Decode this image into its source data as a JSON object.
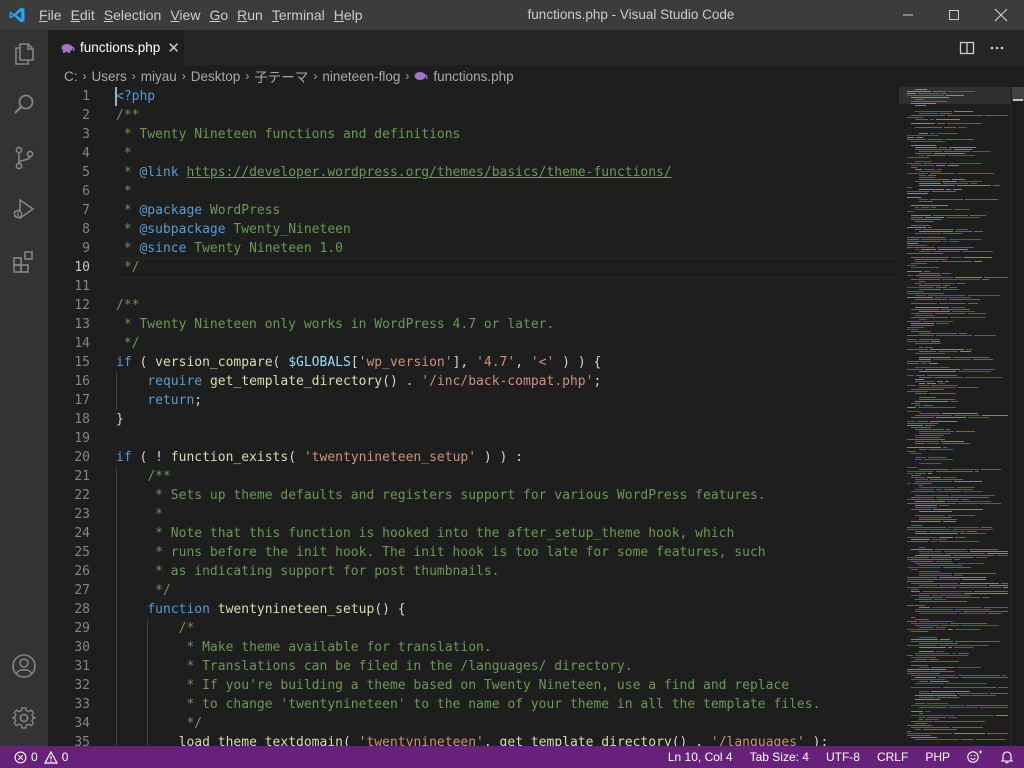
{
  "window": {
    "title": "functions.php - Visual Studio Code",
    "menu": [
      "File",
      "Edit",
      "Selection",
      "View",
      "Go",
      "Run",
      "Terminal",
      "Help"
    ],
    "menu_mnemonic_index": [
      0,
      0,
      0,
      0,
      0,
      0,
      0,
      0
    ]
  },
  "activity_bar": {
    "top": [
      "files-icon",
      "search-icon",
      "source-control-icon",
      "run-debug-icon",
      "extensions-icon"
    ],
    "bottom": [
      "account-icon",
      "manage-gear-icon"
    ],
    "active": "files-icon"
  },
  "tab": {
    "label": "functions.php",
    "close": "✕",
    "icon": "php-elephant-icon"
  },
  "breadcrumb": {
    "items": [
      "C:",
      "Users",
      "miyau",
      "Desktop",
      "子テーマ",
      "nineteen-flog"
    ],
    "file": "functions.php"
  },
  "editor": {
    "active_line": 10,
    "lines": [
      {
        "n": "1",
        "indent": 0,
        "tokens": [
          [
            "tag",
            "<?php"
          ]
        ]
      },
      {
        "n": "2",
        "indent": 0,
        "tokens": [
          [
            "cm",
            "/**"
          ]
        ]
      },
      {
        "n": "3",
        "indent": 0,
        "tokens": [
          [
            "cm",
            " * Twenty Nineteen functions and definitions"
          ]
        ]
      },
      {
        "n": "4",
        "indent": 0,
        "tokens": [
          [
            "cm",
            " *"
          ]
        ]
      },
      {
        "n": "5",
        "indent": 0,
        "tokens": [
          [
            "cm",
            " * "
          ],
          [
            "kw",
            "@link"
          ],
          [
            "cm",
            " "
          ],
          [
            "link",
            "https://developer.wordpress.org/themes/basics/theme-functions/"
          ]
        ]
      },
      {
        "n": "6",
        "indent": 0,
        "tokens": [
          [
            "cm",
            " *"
          ]
        ]
      },
      {
        "n": "7",
        "indent": 0,
        "tokens": [
          [
            "cm",
            " * "
          ],
          [
            "kw",
            "@package"
          ],
          [
            "cm",
            " WordPress"
          ]
        ]
      },
      {
        "n": "8",
        "indent": 0,
        "tokens": [
          [
            "cm",
            " * "
          ],
          [
            "kw",
            "@subpackage"
          ],
          [
            "cm",
            " Twenty_Nineteen"
          ]
        ]
      },
      {
        "n": "9",
        "indent": 0,
        "tokens": [
          [
            "cm",
            " * "
          ],
          [
            "kw",
            "@since"
          ],
          [
            "cm",
            " Twenty Nineteen 1.0"
          ]
        ]
      },
      {
        "n": "10",
        "indent": 0,
        "tokens": [
          [
            "cm",
            " */"
          ]
        ]
      },
      {
        "n": "11",
        "indent": 0,
        "tokens": []
      },
      {
        "n": "12",
        "indent": 0,
        "tokens": [
          [
            "cm",
            "/**"
          ]
        ]
      },
      {
        "n": "13",
        "indent": 0,
        "tokens": [
          [
            "cm",
            " * Twenty Nineteen only works in WordPress 4.7 or later."
          ]
        ]
      },
      {
        "n": "14",
        "indent": 0,
        "tokens": [
          [
            "cm",
            " */"
          ]
        ]
      },
      {
        "n": "15",
        "indent": 0,
        "tokens": [
          [
            "kw",
            "if"
          ],
          [
            "txt",
            " ( "
          ],
          [
            "fn",
            "version_compare"
          ],
          [
            "txt",
            "( "
          ],
          [
            "var",
            "$GLOBALS"
          ],
          [
            "txt",
            "["
          ],
          [
            "str",
            "'wp_version'"
          ],
          [
            "txt",
            "], "
          ],
          [
            "str",
            "'4.7'"
          ],
          [
            "txt",
            ", "
          ],
          [
            "str",
            "'<'"
          ],
          [
            "txt",
            " ) ) {"
          ]
        ]
      },
      {
        "n": "16",
        "indent": 1,
        "tokens": [
          [
            "txt",
            "    "
          ],
          [
            "kw",
            "require"
          ],
          [
            "txt",
            " "
          ],
          [
            "fn",
            "get_template_directory"
          ],
          [
            "txt",
            "() . "
          ],
          [
            "str",
            "'/inc/back-compat.php'"
          ],
          [
            "txt",
            ";"
          ]
        ]
      },
      {
        "n": "17",
        "indent": 1,
        "tokens": [
          [
            "txt",
            "    "
          ],
          [
            "kw",
            "return"
          ],
          [
            "txt",
            ";"
          ]
        ]
      },
      {
        "n": "18",
        "indent": 0,
        "tokens": [
          [
            "txt",
            "}"
          ]
        ]
      },
      {
        "n": "19",
        "indent": 0,
        "tokens": []
      },
      {
        "n": "20",
        "indent": 0,
        "tokens": [
          [
            "kw",
            "if"
          ],
          [
            "txt",
            " ( ! "
          ],
          [
            "fn",
            "function_exists"
          ],
          [
            "txt",
            "( "
          ],
          [
            "str",
            "'twentynineteen_setup'"
          ],
          [
            "txt",
            " ) ) :"
          ]
        ]
      },
      {
        "n": "21",
        "indent": 1,
        "tokens": [
          [
            "txt",
            "    "
          ],
          [
            "cm",
            "/**"
          ]
        ]
      },
      {
        "n": "22",
        "indent": 1,
        "tokens": [
          [
            "txt",
            "    "
          ],
          [
            "cm",
            " * Sets up theme defaults and registers support for various WordPress features."
          ]
        ]
      },
      {
        "n": "23",
        "indent": 1,
        "tokens": [
          [
            "txt",
            "    "
          ],
          [
            "cm",
            " *"
          ]
        ]
      },
      {
        "n": "24",
        "indent": 1,
        "tokens": [
          [
            "txt",
            "    "
          ],
          [
            "cm",
            " * Note that this function is hooked into the after_setup_theme hook, which"
          ]
        ]
      },
      {
        "n": "25",
        "indent": 1,
        "tokens": [
          [
            "txt",
            "    "
          ],
          [
            "cm",
            " * runs before the init hook. The init hook is too late for some features, such"
          ]
        ]
      },
      {
        "n": "26",
        "indent": 1,
        "tokens": [
          [
            "txt",
            "    "
          ],
          [
            "cm",
            " * as indicating support for post thumbnails."
          ]
        ]
      },
      {
        "n": "27",
        "indent": 1,
        "tokens": [
          [
            "txt",
            "    "
          ],
          [
            "cm",
            " */"
          ]
        ]
      },
      {
        "n": "28",
        "indent": 1,
        "tokens": [
          [
            "txt",
            "    "
          ],
          [
            "kw",
            "function"
          ],
          [
            "txt",
            " "
          ],
          [
            "fn",
            "twentynineteen_setup"
          ],
          [
            "txt",
            "() {"
          ]
        ]
      },
      {
        "n": "29",
        "indent": 2,
        "tokens": [
          [
            "txt",
            "        "
          ],
          [
            "cm",
            "/*"
          ]
        ]
      },
      {
        "n": "30",
        "indent": 2,
        "tokens": [
          [
            "txt",
            "        "
          ],
          [
            "cm",
            " * Make theme available for translation."
          ]
        ]
      },
      {
        "n": "31",
        "indent": 2,
        "tokens": [
          [
            "txt",
            "        "
          ],
          [
            "cm",
            " * Translations can be filed in the /languages/ directory."
          ]
        ]
      },
      {
        "n": "32",
        "indent": 2,
        "tokens": [
          [
            "txt",
            "        "
          ],
          [
            "cm",
            " * If you're building a theme based on Twenty Nineteen, use a find and replace"
          ]
        ]
      },
      {
        "n": "33",
        "indent": 2,
        "tokens": [
          [
            "txt",
            "        "
          ],
          [
            "cm",
            " * to change 'twentynineteen' to the name of your theme in all the template files."
          ]
        ]
      },
      {
        "n": "34",
        "indent": 2,
        "tokens": [
          [
            "txt",
            "        "
          ],
          [
            "cm",
            " */"
          ]
        ]
      },
      {
        "n": "35",
        "indent": 2,
        "tokens": [
          [
            "txt",
            "        "
          ],
          [
            "fn",
            "load_theme_textdomain"
          ],
          [
            "txt",
            "( "
          ],
          [
            "str",
            "'twentynineteen'"
          ],
          [
            "txt",
            ", "
          ],
          [
            "fn",
            "get_template_directory"
          ],
          [
            "txt",
            "() . "
          ],
          [
            "str",
            "'/languages'"
          ],
          [
            "txt",
            " );"
          ]
        ]
      }
    ]
  },
  "statusbar": {
    "errors": "0",
    "warnings": "0",
    "position": "Ln 10, Col 4",
    "tab_size": "Tab Size: 4",
    "encoding": "UTF-8",
    "eol": "CRLF",
    "language": "PHP",
    "color": "#68217a"
  },
  "colors": {
    "comment": "#6a9955",
    "keyword": "#569cd6",
    "function": "#dcdcaa",
    "string": "#ce9178",
    "variable": "#9cdcfe",
    "accent_blue": "#23a9f2"
  }
}
